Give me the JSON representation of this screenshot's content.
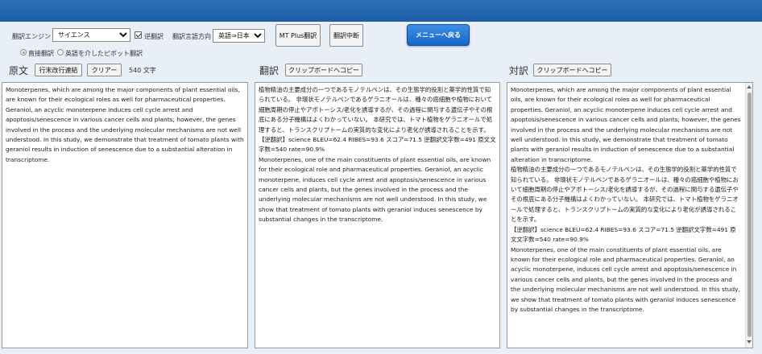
{
  "toolbar": {
    "engine_label": "翻訳エンジン",
    "engine_value": "サイエンス",
    "reverse_label": "逆翻訳",
    "direction_label": "翻訳言語方向",
    "direction_value": "英語⇒日本語",
    "mt_plus_button": "MT Plus翻訳",
    "stop_button": "翻訳中断",
    "menu_button": "メニューへ戻る",
    "radio_direct": "直接翻訳",
    "radio_pivot": "英語を介したピボット翻訳"
  },
  "source": {
    "heading": "原文",
    "join_button": "行末改行連結",
    "clear_button": "クリアー",
    "char_count": "540 文字",
    "text": "Monoterpenes, which are among the major components of plant essential oils, are known for their ecological roles as well for pharmaceutical properties. Geraniol, an acyclic monoterpene induces cell cycle arrest and apoptosis/senescence in various cancer cells and plants; however, the genes involved in the process and the underlying molecular mechanisms are not well understood. In this study, we demonstrate that treatment of tomato plants with geraniol results in induction of senescence due to a substantial alteration in transcriptome."
  },
  "translation": {
    "heading": "翻訳",
    "copy_button": "クリップボードへコピー",
    "paragraphs": [
      "植物精油の主要成分の一つであるモノテルペンは、その生態学的役割と薬学的性質で知られている。 非環状モノテルペンであるゲラニオールは、種々の癌細胞や植物において細胞周期の停止やアポトーシス/老化を誘導するが、その過程に関与する遺伝子やその根底にある分子機構はよくわかっていない。 本研究では、トマト植物をゲラニオールで処理すると、トランスクリプトームの実質的な変化により老化が誘導されることを示す。",
      "【逆翻訳】science BLEU=62.4 RIBES=93.6 スコア=71.5 逆翻訳文字数=491 原文文字数=540 rate=90.9%",
      "Monoterpenes, one of the main constituents of plant essential oils, are known for their ecological role and pharmaceutical properties. Geraniol, an acyclic monoterpene, induces cell cycle arrest and apoptosis/senescence in various cancer cells and plants, but the genes involved in the process and the underlying molecular mechanisms are not well understood. In this study, we show that treatment of tomato plants with geraniol induces senescence by substantial changes in the transcriptome."
    ]
  },
  "parallel": {
    "heading": "対訳",
    "copy_button": "クリップボードへコピー",
    "paragraphs": [
      "Monoterpenes, which are among the major components of plant essential oils, are known for their ecological roles as well for pharmaceutical properties. Geraniol, an acyclic monoterpene induces cell cycle arrest and apoptosis/senescence in various cancer cells and plants; however, the genes involved in the process and the underlying molecular mechanisms are not well understood. In this study, we demonstrate that treatment of tomato plants with geraniol results in induction of senescence due to a substantial alteration in transcriptome.",
      "植物精油の主要成分の一つであるモノテルペンは、その生態学的役割と薬学的性質で知られている。 非環状モノテルペンであるゲラニオールは、種々の癌細胞や植物において細胞周期の停止やアポトーシス/老化を誘導するが、その過程に関与する遺伝子やその根底にある分子機構はよくわかっていない。 本研究では、トマト植物をゲラニオールで処理すると、トランスクリプトームの実質的な変化により老化が誘導されることを示す。",
      "【逆翻訳】science BLEU=62.4 RIBES=93.6 スコア=71.5 逆翻訳文字数=491 原文文字数=540 rate=90.9%",
      "Monoterpenes, one of the main constituents of plant essential oils, are known for their ecological role and pharmaceutical properties. Geraniol, an acyclic monoterpene, induces cell cycle arrest and apoptosis/senescence in various cancer cells and plants, but the genes involved in the process and the underlying molecular mechanisms are not well understood. In this study, we show that treatment of tomato plants with geraniol induces senescence by substantial changes in the transcriptome."
    ]
  }
}
